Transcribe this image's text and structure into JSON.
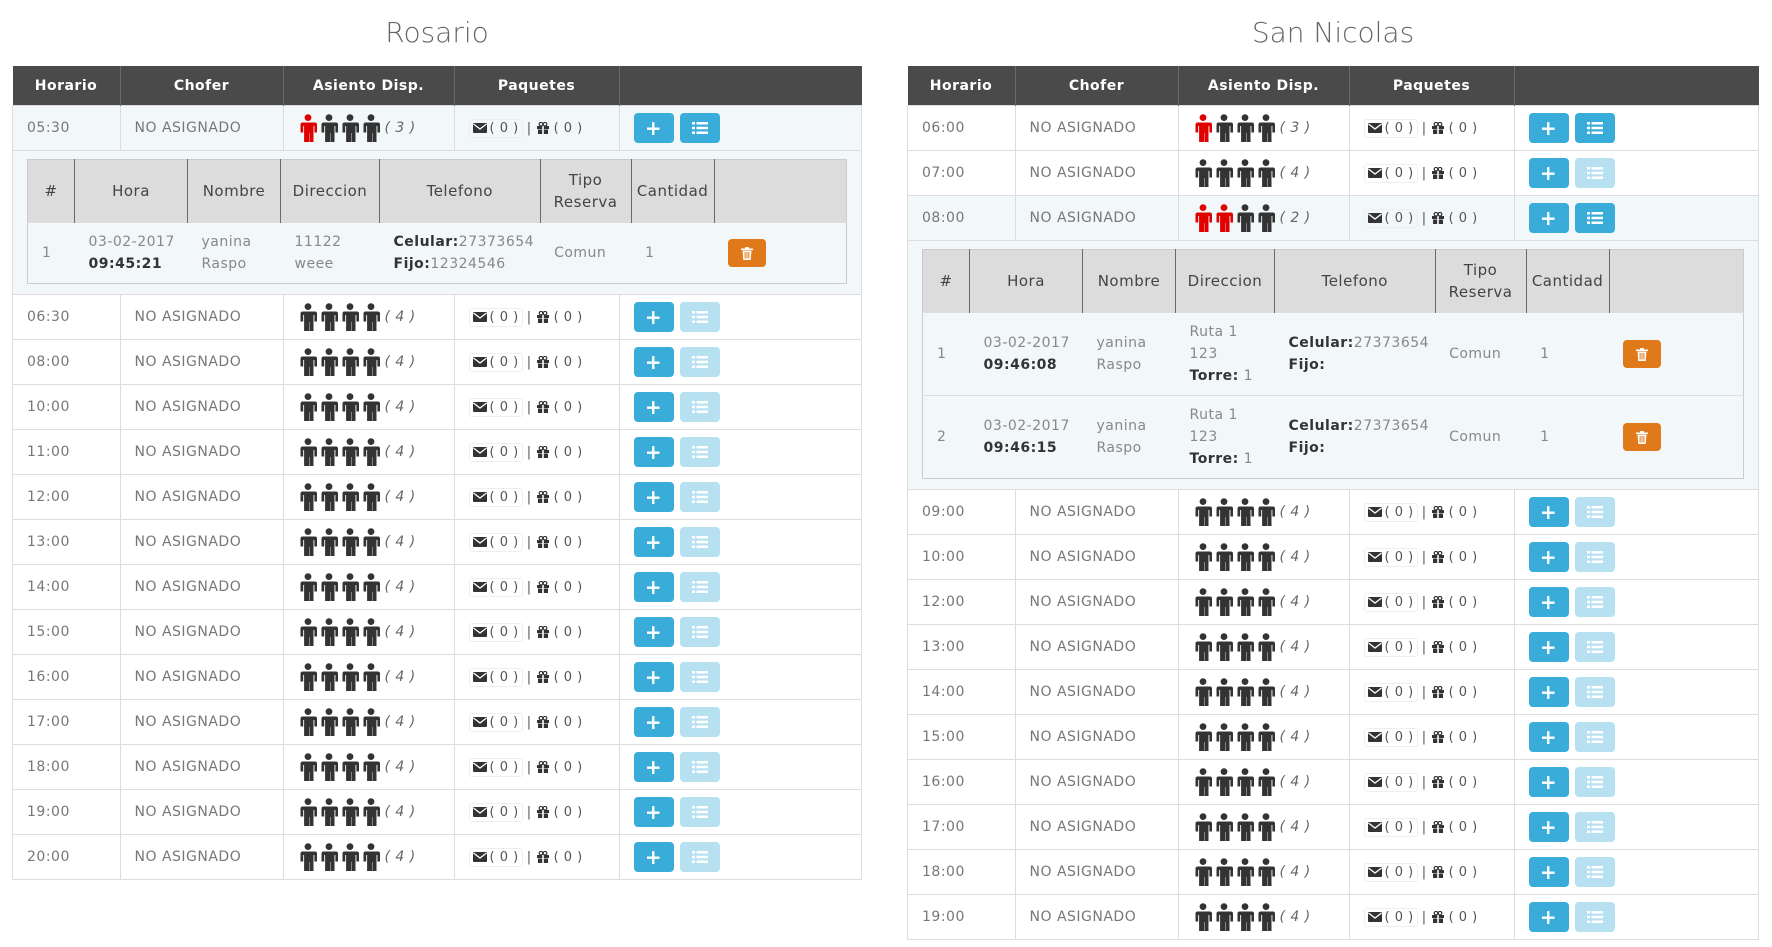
{
  "columns": [
    "Horario",
    "Chofer",
    "Asiento Disp.",
    "Paquetes",
    ""
  ],
  "detail_columns": [
    "#",
    "Hora",
    "Nombre",
    "Direccion",
    "Telefono",
    "Tipo Reserva",
    "Cantidad"
  ],
  "colors": {
    "seat_taken": "#e00000",
    "seat_free": "#333333",
    "primary": "#39acd9",
    "primary_disabled": "#b7e1f1",
    "danger": "#e0791a",
    "header_bg": "#4a4a4a"
  },
  "left": {
    "city": "Rosario",
    "rows": [
      {
        "time": "05:30",
        "driver": "NO ASIGNADO",
        "taken": 1,
        "available": "( 3 )",
        "mail": "( 0 )",
        "pkg": "( 0 )",
        "list_enabled": true,
        "selected": true,
        "reservations": [
          {
            "num": "1",
            "date": "03-02-2017",
            "hour": "09:45:21",
            "name_first": "yanina",
            "name_last": "Raspo",
            "addr": [
              "11122",
              "weee"
            ],
            "torre": "",
            "cel": "27373654",
            "fijo": "12324546",
            "tipo": "Comun",
            "cantidad": "1"
          }
        ]
      },
      {
        "time": "06:30",
        "driver": "NO ASIGNADO",
        "taken": 0,
        "available": "( 4 )",
        "mail": "( 0 )",
        "pkg": "( 0 )",
        "list_enabled": false
      },
      {
        "time": "08:00",
        "driver": "NO ASIGNADO",
        "taken": 0,
        "available": "( 4 )",
        "mail": "( 0 )",
        "pkg": "( 0 )",
        "list_enabled": false
      },
      {
        "time": "10:00",
        "driver": "NO ASIGNADO",
        "taken": 0,
        "available": "( 4 )",
        "mail": "( 0 )",
        "pkg": "( 0 )",
        "list_enabled": false
      },
      {
        "time": "11:00",
        "driver": "NO ASIGNADO",
        "taken": 0,
        "available": "( 4 )",
        "mail": "( 0 )",
        "pkg": "( 0 )",
        "list_enabled": false
      },
      {
        "time": "12:00",
        "driver": "NO ASIGNADO",
        "taken": 0,
        "available": "( 4 )",
        "mail": "( 0 )",
        "pkg": "( 0 )",
        "list_enabled": false
      },
      {
        "time": "13:00",
        "driver": "NO ASIGNADO",
        "taken": 0,
        "available": "( 4 )",
        "mail": "( 0 )",
        "pkg": "( 0 )",
        "list_enabled": false
      },
      {
        "time": "14:00",
        "driver": "NO ASIGNADO",
        "taken": 0,
        "available": "( 4 )",
        "mail": "( 0 )",
        "pkg": "( 0 )",
        "list_enabled": false
      },
      {
        "time": "15:00",
        "driver": "NO ASIGNADO",
        "taken": 0,
        "available": "( 4 )",
        "mail": "( 0 )",
        "pkg": "( 0 )",
        "list_enabled": false
      },
      {
        "time": "16:00",
        "driver": "NO ASIGNADO",
        "taken": 0,
        "available": "( 4 )",
        "mail": "( 0 )",
        "pkg": "( 0 )",
        "list_enabled": false
      },
      {
        "time": "17:00",
        "driver": "NO ASIGNADO",
        "taken": 0,
        "available": "( 4 )",
        "mail": "( 0 )",
        "pkg": "( 0 )",
        "list_enabled": false
      },
      {
        "time": "18:00",
        "driver": "NO ASIGNADO",
        "taken": 0,
        "available": "( 4 )",
        "mail": "( 0 )",
        "pkg": "( 0 )",
        "list_enabled": false
      },
      {
        "time": "19:00",
        "driver": "NO ASIGNADO",
        "taken": 0,
        "available": "( 4 )",
        "mail": "( 0 )",
        "pkg": "( 0 )",
        "list_enabled": false
      },
      {
        "time": "20:00",
        "driver": "NO ASIGNADO",
        "taken": 0,
        "available": "( 4 )",
        "mail": "( 0 )",
        "pkg": "( 0 )",
        "list_enabled": false
      }
    ]
  },
  "right": {
    "city": "San Nicolas",
    "rows": [
      {
        "time": "06:00",
        "driver": "NO ASIGNADO",
        "taken": 1,
        "available": "( 3 )",
        "mail": "( 0 )",
        "pkg": "( 0 )",
        "list_enabled": true
      },
      {
        "time": "07:00",
        "driver": "NO ASIGNADO",
        "taken": 0,
        "available": "( 4 )",
        "mail": "( 0 )",
        "pkg": "( 0 )",
        "list_enabled": false
      },
      {
        "time": "08:00",
        "driver": "NO ASIGNADO",
        "taken": 2,
        "available": "( 2 )",
        "mail": "( 0 )",
        "pkg": "( 0 )",
        "list_enabled": true,
        "selected": true,
        "reservations": [
          {
            "num": "1",
            "date": "03-02-2017",
            "hour": "09:46:08",
            "name_first": "yanina",
            "name_last": "Raspo",
            "addr": [
              "Ruta 1",
              "123"
            ],
            "torre": "1",
            "cel": "27373654",
            "fijo": "",
            "tipo": "Comun",
            "cantidad": "1"
          },
          {
            "num": "2",
            "date": "03-02-2017",
            "hour": "09:46:15",
            "name_first": "yanina",
            "name_last": "Raspo",
            "addr": [
              "Ruta 1",
              "123"
            ],
            "torre": "1",
            "cel": "27373654",
            "fijo": "",
            "tipo": "Comun",
            "cantidad": "1"
          }
        ]
      },
      {
        "time": "09:00",
        "driver": "NO ASIGNADO",
        "taken": 0,
        "available": "( 4 )",
        "mail": "( 0 )",
        "pkg": "( 0 )",
        "list_enabled": false
      },
      {
        "time": "10:00",
        "driver": "NO ASIGNADO",
        "taken": 0,
        "available": "( 4 )",
        "mail": "( 0 )",
        "pkg": "( 0 )",
        "list_enabled": false
      },
      {
        "time": "12:00",
        "driver": "NO ASIGNADO",
        "taken": 0,
        "available": "( 4 )",
        "mail": "( 0 )",
        "pkg": "( 0 )",
        "list_enabled": false
      },
      {
        "time": "13:00",
        "driver": "NO ASIGNADO",
        "taken": 0,
        "available": "( 4 )",
        "mail": "( 0 )",
        "pkg": "( 0 )",
        "list_enabled": false
      },
      {
        "time": "14:00",
        "driver": "NO ASIGNADO",
        "taken": 0,
        "available": "( 4 )",
        "mail": "( 0 )",
        "pkg": "( 0 )",
        "list_enabled": false
      },
      {
        "time": "15:00",
        "driver": "NO ASIGNADO",
        "taken": 0,
        "available": "( 4 )",
        "mail": "( 0 )",
        "pkg": "( 0 )",
        "list_enabled": false
      },
      {
        "time": "16:00",
        "driver": "NO ASIGNADO",
        "taken": 0,
        "available": "( 4 )",
        "mail": "( 0 )",
        "pkg": "( 0 )",
        "list_enabled": false
      },
      {
        "time": "17:00",
        "driver": "NO ASIGNADO",
        "taken": 0,
        "available": "( 4 )",
        "mail": "( 0 )",
        "pkg": "( 0 )",
        "list_enabled": false
      },
      {
        "time": "18:00",
        "driver": "NO ASIGNADO",
        "taken": 0,
        "available": "( 4 )",
        "mail": "( 0 )",
        "pkg": "( 0 )",
        "list_enabled": false
      },
      {
        "time": "19:00",
        "driver": "NO ASIGNADO",
        "taken": 0,
        "available": "( 4 )",
        "mail": "( 0 )",
        "pkg": "( 0 )",
        "list_enabled": false
      }
    ]
  },
  "labels": {
    "celular": "Celular:",
    "fijo": "Fijo:",
    "torre": "Torre:",
    "add": "+"
  }
}
